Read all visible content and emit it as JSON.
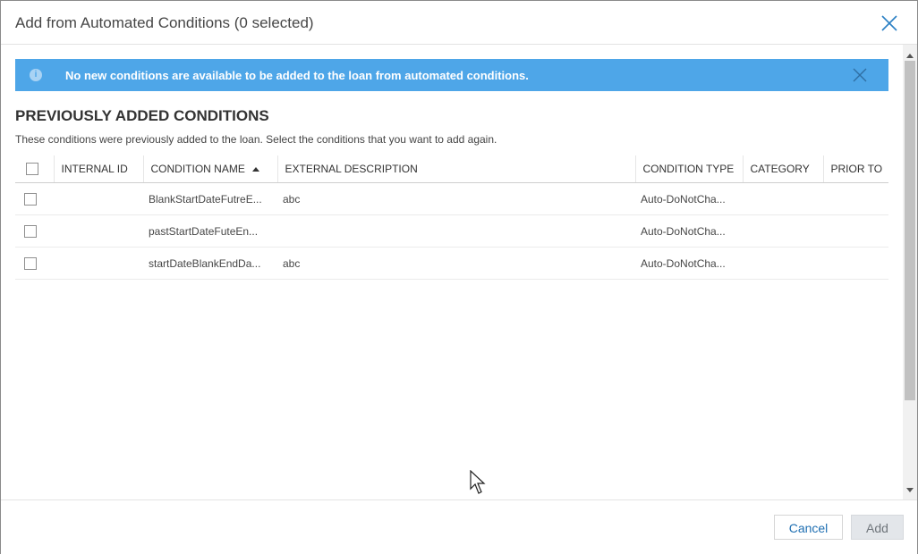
{
  "dialog": {
    "title": "Add from Automated Conditions (0 selected)"
  },
  "banner": {
    "icon": "info-icon",
    "message": "No new conditions are available to be added to the loan from automated conditions."
  },
  "section": {
    "title": "PREVIOUSLY ADDED CONDITIONS",
    "description": "These conditions were previously added to the loan. Select the conditions that you want to add again."
  },
  "table": {
    "columns": {
      "internal_id": "INTERNAL ID",
      "condition_name": "CONDITION NAME",
      "external_description": "EXTERNAL DESCRIPTION",
      "condition_type": "CONDITION TYPE",
      "category": "CATEGORY",
      "prior_to": "PRIOR TO"
    },
    "sort": {
      "column": "condition_name",
      "direction": "ascending"
    },
    "rows": [
      {
        "internal_id": "",
        "condition_name": "BlankStartDateFutreE...",
        "external_description": "abc",
        "condition_type": "Auto-DoNotCha...",
        "category": "",
        "prior_to": ""
      },
      {
        "internal_id": "",
        "condition_name": "pastStartDateFuteEn...",
        "external_description": "",
        "condition_type": "Auto-DoNotCha...",
        "category": "",
        "prior_to": ""
      },
      {
        "internal_id": "",
        "condition_name": "startDateBlankEndDa...",
        "external_description": "abc",
        "condition_type": "Auto-DoNotCha...",
        "category": "",
        "prior_to": ""
      }
    ]
  },
  "footer": {
    "cancel_label": "Cancel",
    "add_label": "Add"
  },
  "colors": {
    "banner_bg": "#4ea6e8",
    "accent_link": "#1f6fb2",
    "disabled_button_bg": "#e3e6ea"
  }
}
